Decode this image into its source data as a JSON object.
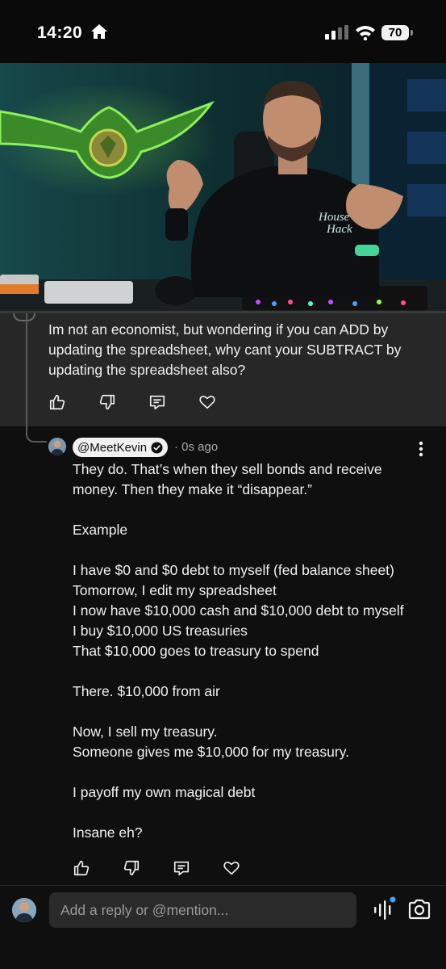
{
  "status_bar": {
    "time": "14:20",
    "battery": "70"
  },
  "video": {
    "shirt_text_line1": "House",
    "shirt_text_line2": "Hack"
  },
  "parent_comment": {
    "text": "Im not an economist, but wondering if you can ADD by updating the spreadsheet, why cant your SUBTRACT by updating the spreadsheet also?"
  },
  "reply": {
    "handle": "@MeetKevin",
    "timestamp": "· 0s ago",
    "paragraphs": [
      "They do. That’s when they sell bonds and receive money. Then they make it “disappear.”",
      "",
      "Example",
      "",
      "I have $0 and $0 debt to myself (fed balance sheet)",
      "Tomorrow, I edit my spreadsheet",
      "I now have $10,000 cash and $10,000 debt to myself",
      "I buy $10,000 US treasuries",
      "That $10,000 goes to treasury to spend",
      "",
      "There. $10,000 from air",
      "",
      "Now, I sell my treasury.",
      "Someone gives me $10,000 for my treasury.",
      "",
      "I payoff my own magical debt",
      "",
      "Insane eh?"
    ]
  },
  "composer": {
    "placeholder": "Add a reply or @mention..."
  },
  "colors": {
    "background": "#0f0f0f",
    "parent_bg": "#272727",
    "input_bg": "#2a2a2a",
    "accent_dot": "#3ea6ff"
  }
}
